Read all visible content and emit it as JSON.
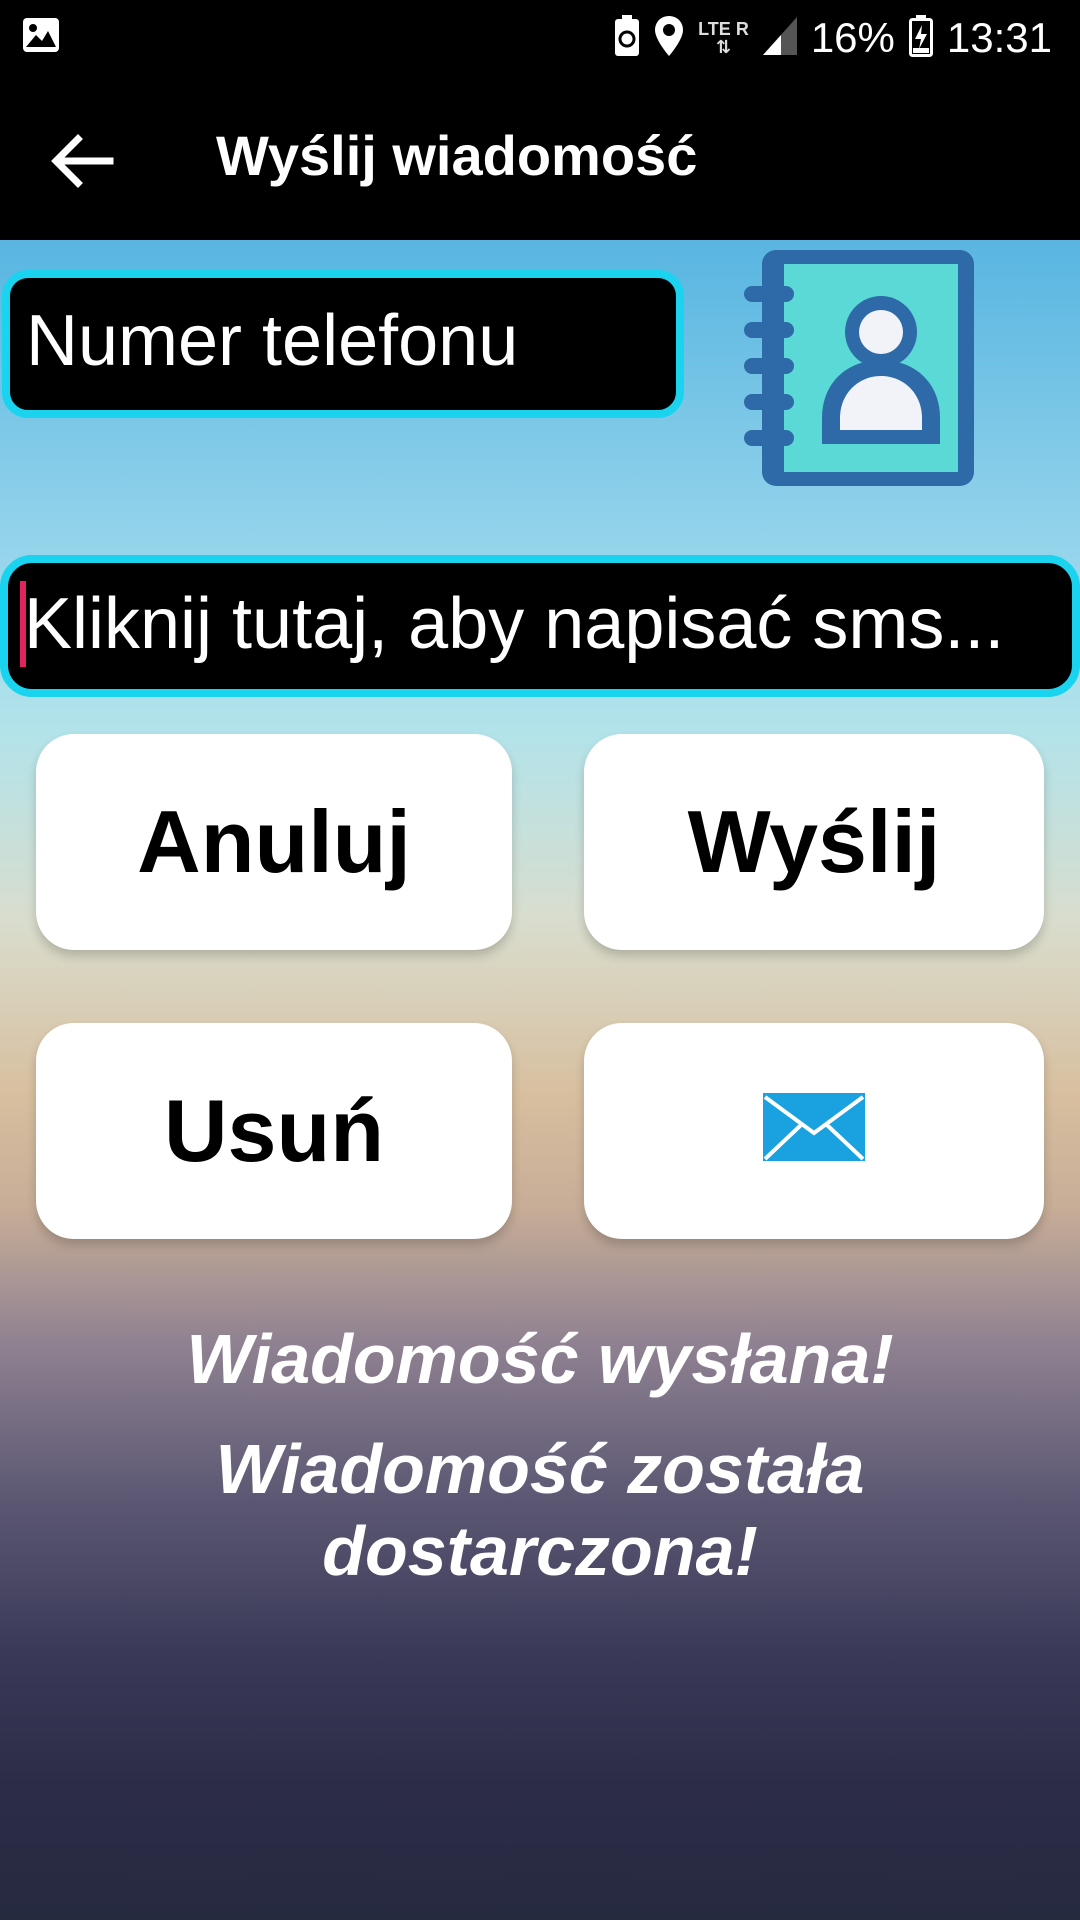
{
  "status_bar": {
    "battery": "16%",
    "time": "13:31",
    "network_label": "LTE",
    "roaming": "R",
    "icons": [
      "image-icon",
      "battery-saver-icon",
      "location-icon",
      "lte-icon",
      "signal-icon",
      "battery-icon"
    ]
  },
  "app_bar": {
    "title": "Wyślij wiadomość",
    "back_icon": "arrow-back-icon"
  },
  "form": {
    "phone_placeholder": "Numer telefonu",
    "sms_placeholder": "Kliknij tutaj, aby napisać sms...",
    "contacts_icon": "contact-book-icon"
  },
  "buttons": {
    "cancel": "Anuluj",
    "send": "Wyślij",
    "delete": "Usuń",
    "mail_icon": "envelope-icon"
  },
  "messages": {
    "sent": "Wiadomość wysłana!",
    "delivered": "Wiadomość została dostarczona!"
  },
  "colors": {
    "input_border": "#1ad3ef",
    "caret": "#e0245e",
    "contact_book_fill": "#5bd9d6",
    "contact_book_stroke": "#2f6aa8",
    "envelope": "#1aa1e0"
  }
}
